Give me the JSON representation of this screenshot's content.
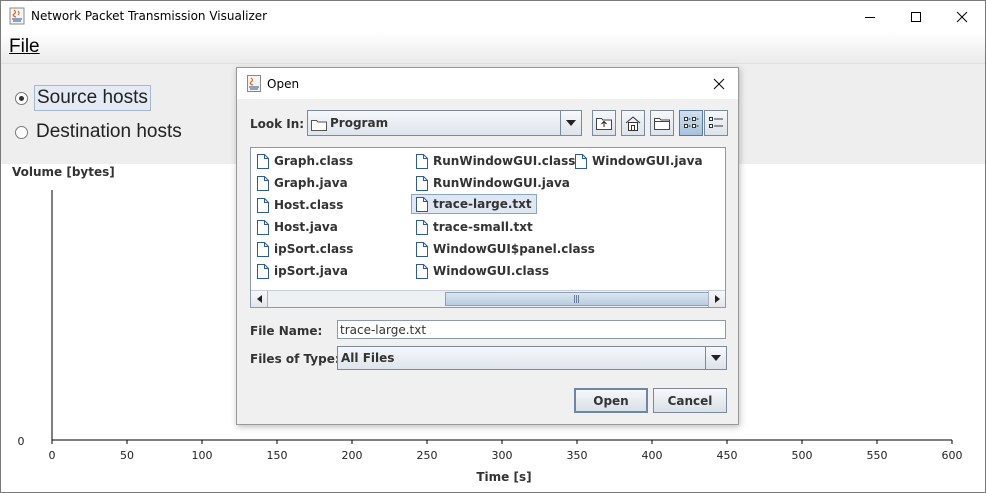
{
  "window": {
    "title": "Network Packet Transmission Visualizer"
  },
  "menu": {
    "file": "File"
  },
  "controls": {
    "source_label": "Source hosts",
    "destination_label": "Destination hosts",
    "selected": "source"
  },
  "chart_data": {
    "type": "line",
    "ylabel": "Volume [bytes]",
    "xlabel": "Time [s]",
    "xlim": [
      0,
      600
    ],
    "x_ticks": [
      "0",
      "50",
      "100",
      "150",
      "200",
      "250",
      "300",
      "350",
      "400",
      "450",
      "500",
      "550",
      "600"
    ],
    "y_ticks": [
      "0"
    ],
    "series": []
  },
  "dialog": {
    "title": "Open",
    "look_in_label": "Look In:",
    "look_in_value": "Program",
    "files": [
      {
        "name": "Graph.class"
      },
      {
        "name": "Graph.java"
      },
      {
        "name": "Host.class"
      },
      {
        "name": "Host.java"
      },
      {
        "name": "ipSort.class"
      },
      {
        "name": "ipSort.java"
      },
      {
        "name": "RunWindowGUI.class"
      },
      {
        "name": "RunWindowGUI.java"
      },
      {
        "name": "trace-large.txt",
        "selected": true
      },
      {
        "name": "trace-small.txt"
      },
      {
        "name": "WindowGUI$panel.class"
      },
      {
        "name": "WindowGUI.class"
      },
      {
        "name": "WindowGUI.java"
      }
    ],
    "file_name_label": "File Name:",
    "file_name_value": "trace-large.txt",
    "files_of_type_label": "Files of Type:",
    "files_of_type_value": "All Files",
    "open_button": "Open",
    "cancel_button": "Cancel",
    "toolbar_icons": [
      "up-one-level-icon",
      "home-icon",
      "new-folder-icon",
      "list-view-icon",
      "details-view-icon"
    ]
  }
}
